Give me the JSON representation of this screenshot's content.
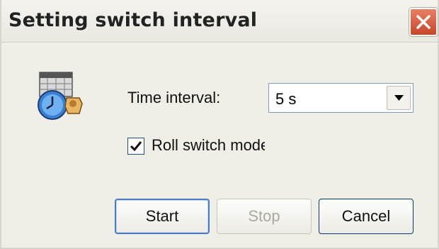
{
  "window": {
    "title": "Setting switch interval",
    "close_icon": "close-icon"
  },
  "form": {
    "app_icon": "clock-calendar-icon",
    "time_interval_label": "Time interval:",
    "time_interval_value": "5 s",
    "dropdown_icon": "chevron-down-icon",
    "roll_switch_label": "Roll switch mode",
    "roll_switch_checked": true
  },
  "buttons": {
    "start_label": "Start",
    "stop_label": "Stop",
    "cancel_label": "Cancel"
  },
  "colors": {
    "close_button": "#c8462a",
    "window_bg": "#efeee7",
    "disabled_text": "#aaa99f"
  }
}
